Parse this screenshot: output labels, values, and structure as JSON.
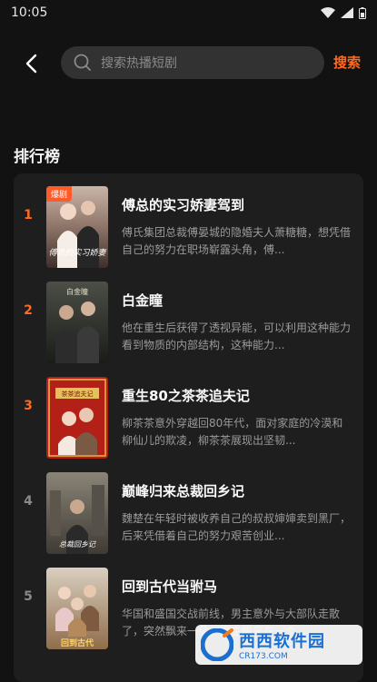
{
  "status": {
    "time": "10:05"
  },
  "search": {
    "placeholder": "搜索热播短剧",
    "button": "搜索"
  },
  "section": {
    "title": "排行榜"
  },
  "colors": {
    "accent": "#ff6a1f",
    "top_rank": "#ff6a1f",
    "rank": "#8a8a8a"
  },
  "items": [
    {
      "rank": "1",
      "title": "傅总的实习娇妻驾到",
      "desc": "傅氏集团总裁傅晏城的隐婚夫人萧糖糖，想凭借自己的努力在职场崭露头角，傅...",
      "tag": "爆剧"
    },
    {
      "rank": "2",
      "title": "白金瞳",
      "desc": "他在重生后获得了透视异能，可以利用这种能力看到物质的内部结构，这种能力...",
      "tag": ""
    },
    {
      "rank": "3",
      "title": "重生80之茶茶追夫记",
      "desc": "柳茶茶意外穿越回80年代，面对家庭的冷漠和柳仙儿的欺凌，柳茶茶展现出坚韧...",
      "tag": ""
    },
    {
      "rank": "4",
      "title": "巅峰归来总裁回乡记",
      "desc": "魏楚在年轻时被收养自己的叔叔婶婶卖到黑厂，后来凭借着自己的努力艰苦创业...",
      "tag": ""
    },
    {
      "rank": "5",
      "title": "回到古代当驸马",
      "desc": "华国和盛国交战前线，男主意外与大部队走散了，突然飘来一朵，男主醒来在一个...",
      "tag": ""
    }
  ],
  "watermark": {
    "main": "西西软件园",
    "sub": "CR173.COM"
  }
}
